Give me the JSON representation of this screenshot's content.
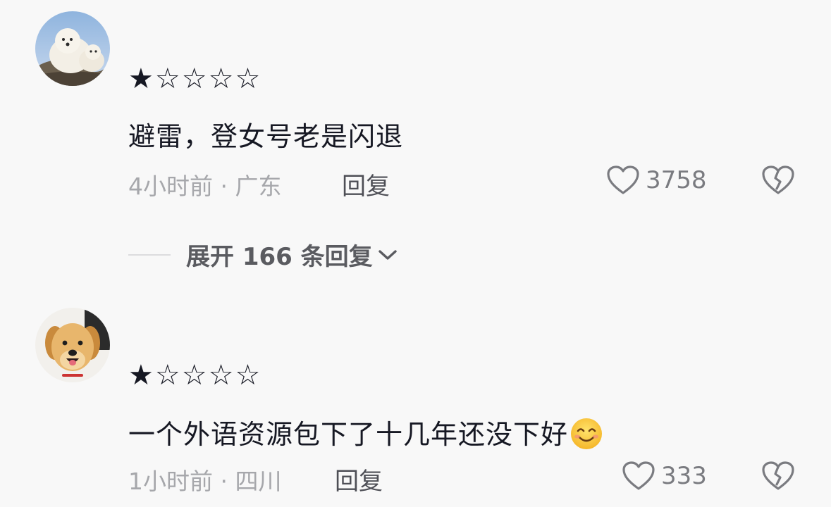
{
  "comments": [
    {
      "avatar_icon": "samoyed-dog-avatar",
      "rating": {
        "filled": "★",
        "empty": "☆☆☆☆"
      },
      "text": "避雷，登女号老是闪退",
      "meta": "4小时前 · 广东",
      "reply_label": "回复",
      "like_count": "3758",
      "expand_label": "展开 166 条回复"
    },
    {
      "avatar_icon": "golden-retriever-avatar",
      "rating": {
        "filled": "★",
        "empty": "☆☆☆☆"
      },
      "text": "一个外语资源包下了十几年还没下好",
      "emoji": "smiling-face-emoji",
      "meta": "1小时前 · 四川",
      "reply_label": "回复",
      "like_count": "333"
    }
  ],
  "colors": {
    "background": "#f8f8f8",
    "text": "#161823",
    "meta": "#a6a7ab",
    "reply": "#4e4f56",
    "icon": "#7a7b80"
  }
}
